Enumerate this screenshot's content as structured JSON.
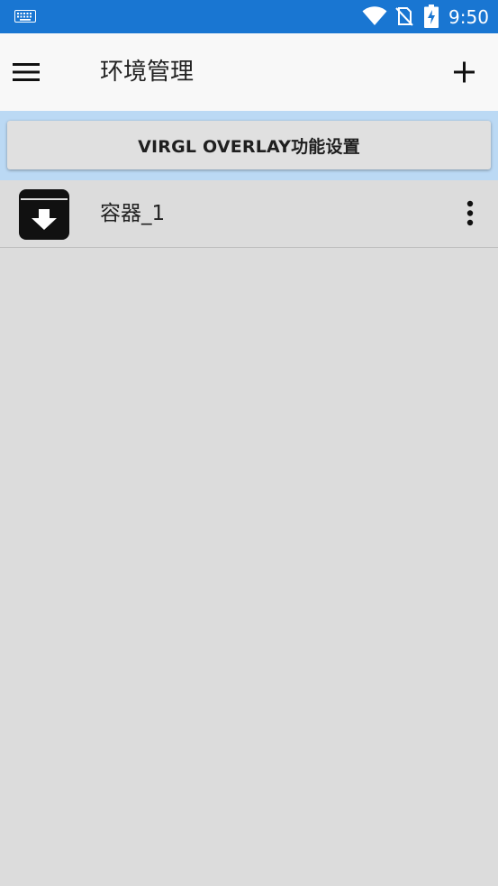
{
  "status_bar": {
    "time": "9:50",
    "icons": [
      "keyboard-icon",
      "wifi-icon",
      "no-sim-icon",
      "battery-charging-icon"
    ]
  },
  "app_bar": {
    "title": "环境管理",
    "menu_icon": "menu-icon",
    "add_icon": "add-icon"
  },
  "virgl_button": {
    "label": "VIRGL OVERLAY功能设置"
  },
  "containers": [
    {
      "label": "容器_1",
      "icon": "archive-download-icon",
      "more_icon": "more-vertical-icon"
    }
  ],
  "colors": {
    "status_bar": "#1976d2",
    "app_bar": "#f8f8f8",
    "virgl_bar": "#bbd9f4",
    "background": "#dcdcdc"
  }
}
